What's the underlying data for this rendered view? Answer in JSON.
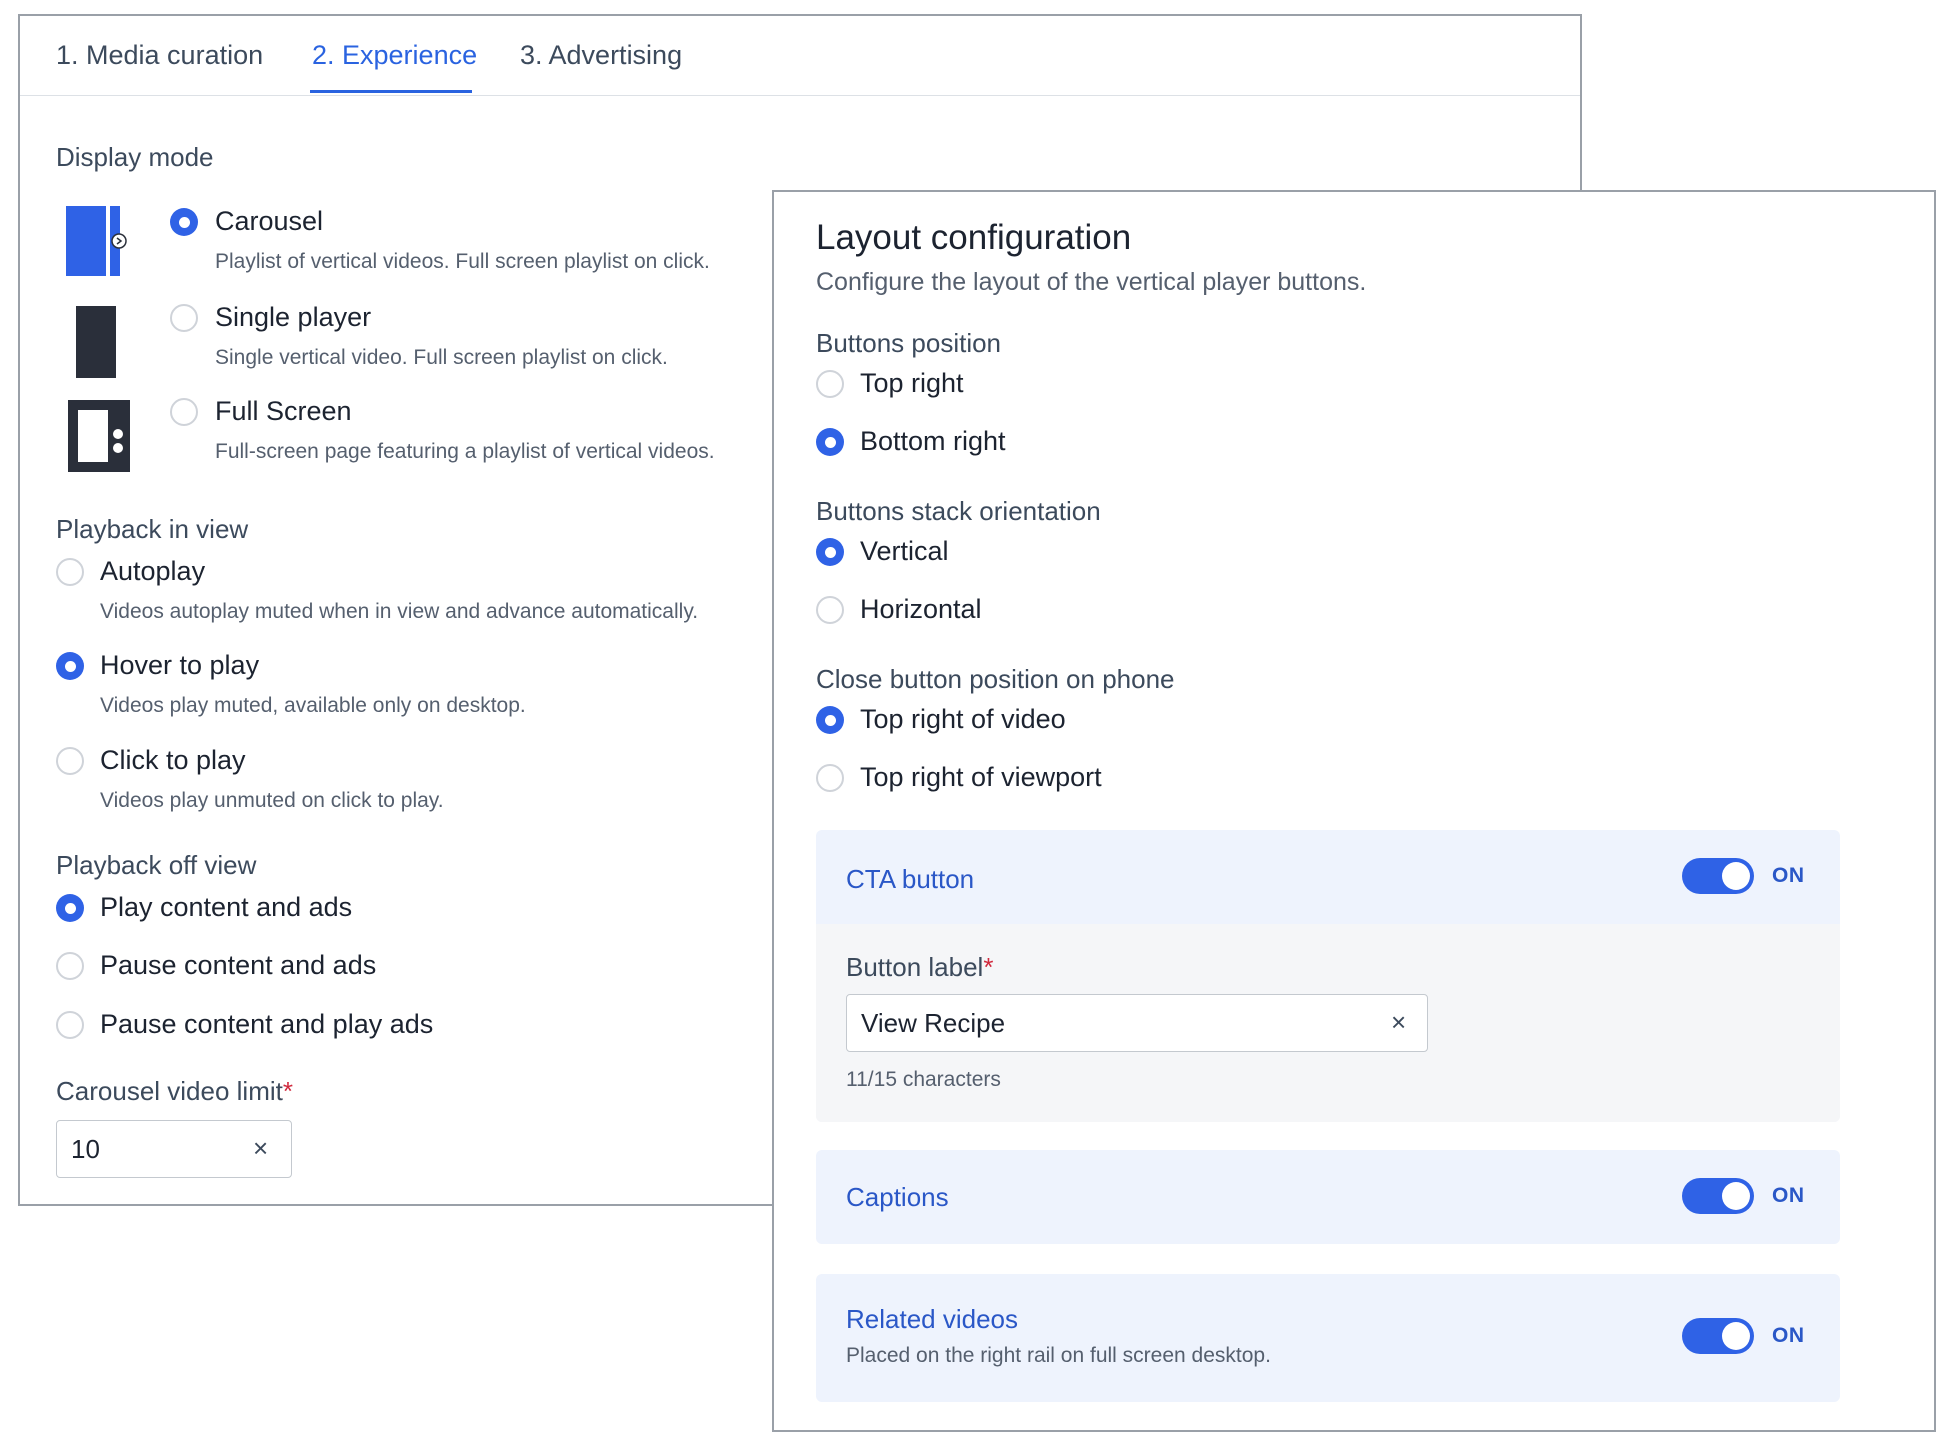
{
  "tabs": [
    {
      "label": "1. Media curation"
    },
    {
      "label": "2. Experience"
    },
    {
      "label": "3. Advertising"
    }
  ],
  "active_tab": "2. Experience",
  "display_mode": {
    "title": "Display mode",
    "options": [
      {
        "label": "Carousel",
        "desc": "Playlist of vertical videos. Full screen playlist on click.",
        "checked": true
      },
      {
        "label": "Single player",
        "desc": "Single vertical video. Full screen playlist on click.",
        "checked": false
      },
      {
        "label": "Full Screen",
        "desc": "Full-screen page featuring a playlist of vertical videos.",
        "checked": false
      }
    ]
  },
  "playback_in_view": {
    "title": "Playback in view",
    "options": [
      {
        "label": "Autoplay",
        "desc": "Videos autoplay muted when in view and advance automatically.",
        "checked": false
      },
      {
        "label": "Hover to play",
        "desc": "Videos play muted, available only on desktop.",
        "checked": true
      },
      {
        "label": "Click to play",
        "desc": "Videos play unmuted on click to play.",
        "checked": false
      }
    ]
  },
  "playback_off_view": {
    "title": "Playback off view",
    "options": [
      {
        "label": "Play content and ads",
        "checked": true
      },
      {
        "label": "Pause content and ads",
        "checked": false
      },
      {
        "label": "Pause content and play ads",
        "checked": false
      }
    ]
  },
  "carousel_limit": {
    "label": "Carousel video limit",
    "required_mark": "*",
    "value": "10",
    "clear_glyph": "×"
  },
  "layout": {
    "title": "Layout configuration",
    "subtitle": "Configure the layout of the vertical player buttons.",
    "buttons_position": {
      "title": "Buttons position",
      "options": [
        {
          "label": "Top right",
          "checked": false
        },
        {
          "label": "Bottom right",
          "checked": true
        }
      ]
    },
    "stack_orientation": {
      "title": "Buttons stack orientation",
      "options": [
        {
          "label": "Vertical",
          "checked": true
        },
        {
          "label": "Horizontal",
          "checked": false
        }
      ]
    },
    "close_position": {
      "title": "Close button position on phone",
      "options": [
        {
          "label": "Top right of video",
          "checked": true
        },
        {
          "label": "Top right of viewport",
          "checked": false
        }
      ]
    },
    "cta": {
      "title": "CTA button",
      "toggle": "ON",
      "field_label": "Button label",
      "required_mark": "*",
      "value": "View Recipe",
      "clear_glyph": "×",
      "counter": "11/15 characters"
    },
    "captions": {
      "title": "Captions",
      "toggle": "ON"
    },
    "related": {
      "title": "Related videos",
      "desc": "Placed on the right rail on full screen desktop.",
      "toggle": "ON"
    }
  },
  "colors": {
    "accent": "#2f62e6",
    "card_bg": "#eef3fd",
    "required": "#d0293d",
    "icon_dark": "#2a2f3a"
  },
  "icons": [
    "carousel-mode-icon",
    "single-player-mode-icon",
    "full-screen-mode-icon",
    "clear-icon"
  ]
}
